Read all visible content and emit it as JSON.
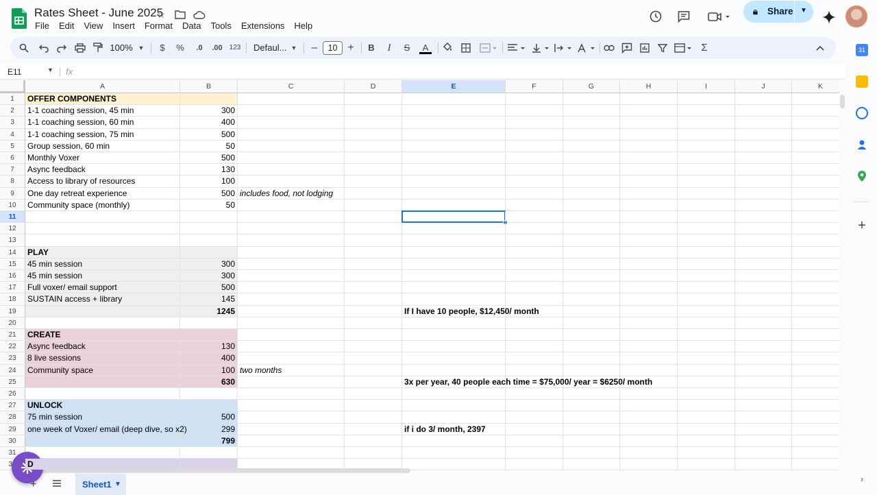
{
  "app": {
    "doc_title": "Rates Sheet - June 2025",
    "menu": [
      "File",
      "Edit",
      "View",
      "Insert",
      "Format",
      "Data",
      "Tools",
      "Extensions",
      "Help"
    ],
    "share_label": "Share"
  },
  "toolbar": {
    "zoom": "100%",
    "currency": "$",
    "percent": "%",
    "dec_decrease": ".0",
    "dec_increase": ".00",
    "number_format": "123",
    "font": "Defaul...",
    "font_size": "10",
    "bold": "B",
    "italic": "I",
    "strike": "S",
    "text_color": "A"
  },
  "formula_bar": {
    "name_box": "E11",
    "fx": "fx",
    "content": ""
  },
  "grid": {
    "columns": [
      "A",
      "B",
      "C",
      "D",
      "E",
      "F",
      "G",
      "H",
      "I",
      "J",
      "K"
    ],
    "selected_column": "E",
    "selected_row": "11",
    "rows": [
      {
        "n": "1",
        "a": "OFFER COMPONENTS",
        "b": "",
        "c": "",
        "e": ""
      },
      {
        "n": "2",
        "a": "1-1 coaching session, 45 min",
        "b": "300",
        "c": "",
        "e": ""
      },
      {
        "n": "3",
        "a": "1-1 coaching session, 60 min",
        "b": "400",
        "c": "",
        "e": ""
      },
      {
        "n": "4",
        "a": "1-1 coaching session, 75 min",
        "b": "500",
        "c": "",
        "e": ""
      },
      {
        "n": "5",
        "a": "Group session, 60 min",
        "b": "50",
        "c": "",
        "e": ""
      },
      {
        "n": "6",
        "a": "Monthly Voxer",
        "b": "500",
        "c": "",
        "e": ""
      },
      {
        "n": "7",
        "a": "Async feedback",
        "b": "130",
        "c": "",
        "e": ""
      },
      {
        "n": "8",
        "a": "Access to library of resources",
        "b": "100",
        "c": "",
        "e": ""
      },
      {
        "n": "9",
        "a": "One day retreat experience",
        "b": "500",
        "c": "includes food, not lodging",
        "e": ""
      },
      {
        "n": "10",
        "a": "Community space (monthly)",
        "b": "50",
        "c": "",
        "e": ""
      },
      {
        "n": "11",
        "a": "",
        "b": "",
        "c": "",
        "e": ""
      },
      {
        "n": "12",
        "a": "",
        "b": "",
        "c": "",
        "e": ""
      },
      {
        "n": "13",
        "a": "",
        "b": "",
        "c": "",
        "e": ""
      },
      {
        "n": "14",
        "a": "PLAY",
        "b": "",
        "c": "",
        "e": ""
      },
      {
        "n": "15",
        "a": "45 min session",
        "b": "300",
        "c": "",
        "e": ""
      },
      {
        "n": "16",
        "a": "45 min session",
        "b": "300",
        "c": "",
        "e": ""
      },
      {
        "n": "17",
        "a": "Full voxer/ email support",
        "b": "500",
        "c": "",
        "e": ""
      },
      {
        "n": "18",
        "a": "SUSTAIN access + library",
        "b": "145",
        "c": "",
        "e": ""
      },
      {
        "n": "19",
        "a": "",
        "b": "1245",
        "c": "",
        "e": "If I have 10 people, $12,450/ month"
      },
      {
        "n": "20",
        "a": "",
        "b": "",
        "c": "",
        "e": ""
      },
      {
        "n": "21",
        "a": "CREATE",
        "b": "",
        "c": "",
        "e": ""
      },
      {
        "n": "22",
        "a": "Async feedback",
        "b": "130",
        "c": "",
        "e": ""
      },
      {
        "n": "23",
        "a": "8 live sessions",
        "b": "400",
        "c": "",
        "e": ""
      },
      {
        "n": "24",
        "a": "Community space",
        "b": "100",
        "c": "two months",
        "e": ""
      },
      {
        "n": "25",
        "a": "",
        "b": "630",
        "c": "",
        "e": "3x per year, 40 people each time = $75,000/ year = $6250/ month"
      },
      {
        "n": "26",
        "a": "",
        "b": "",
        "c": "",
        "e": ""
      },
      {
        "n": "27",
        "a": "UNLOCK",
        "b": "",
        "c": "",
        "e": ""
      },
      {
        "n": "28",
        "a": "75 min session",
        "b": "500",
        "c": "",
        "e": ""
      },
      {
        "n": "29",
        "a": "one week of Voxer/ email (deep dive, so x2)",
        "b": "299",
        "c": "",
        "e": "if i do 3/ month, 2397"
      },
      {
        "n": "30",
        "a": "",
        "b": "799",
        "c": "",
        "e": ""
      },
      {
        "n": "31",
        "a": "",
        "b": "",
        "c": "",
        "e": ""
      },
      {
        "n": "32",
        "a": "D",
        "b": "",
        "c": "",
        "e": ""
      }
    ]
  },
  "bottom": {
    "sheet_tab": "Sheet1"
  },
  "colors": {
    "header_fill": "#fff2cc",
    "play_fill": "#efefef",
    "create_fill": "#ead1dc",
    "unlock_fill": "#cfe2f3",
    "next_fill": "#d9d2e9",
    "accent": "#1a73e8"
  }
}
